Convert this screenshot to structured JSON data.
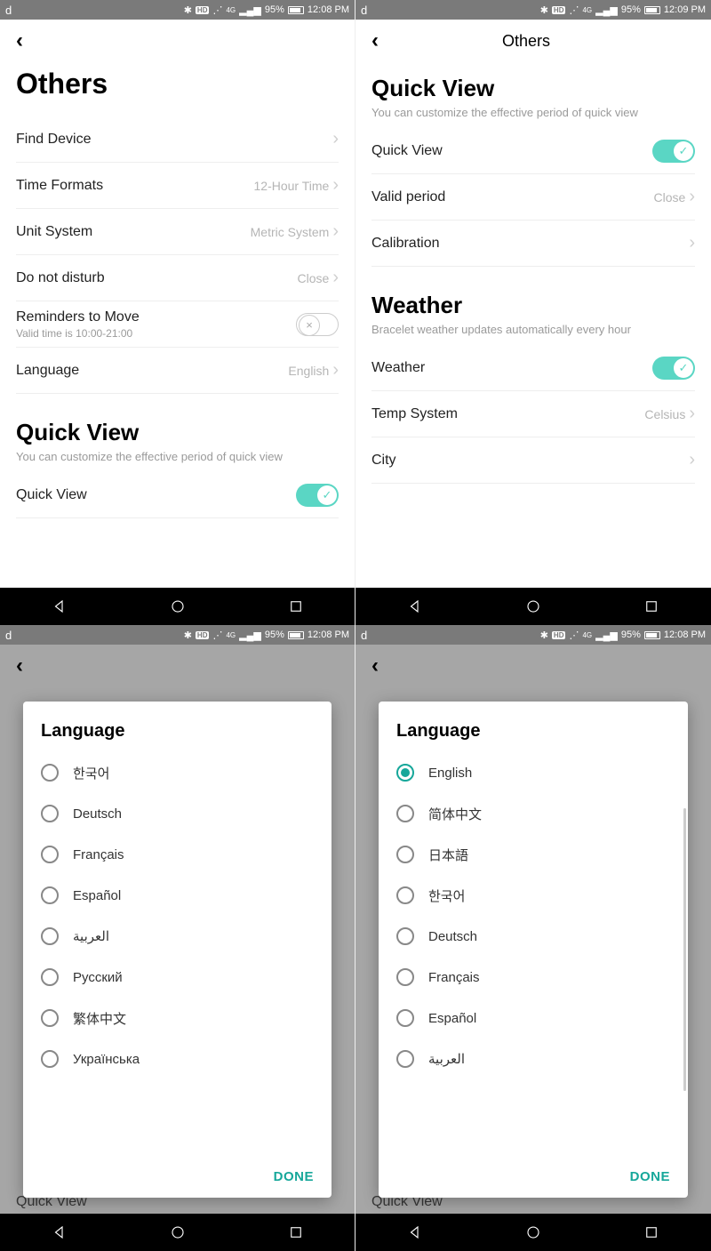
{
  "status": {
    "d": "d",
    "battery": "95%",
    "time1": "12:08 PM",
    "time2": "12:09 PM",
    "hd": "HD",
    "net": "4G"
  },
  "s1": {
    "title": "Others",
    "rows": {
      "find": "Find Device",
      "tf": "Time Formats",
      "tf_v": "12-Hour Time",
      "us": "Unit System",
      "us_v": "Metric System",
      "dnd": "Do not disturb",
      "dnd_v": "Close",
      "rem": "Reminders to Move",
      "rem_sub": "Valid time is 10:00-21:00",
      "lang": "Language",
      "lang_v": "English"
    },
    "qv_title": "Quick View",
    "qv_sub": "You can customize the effective period of quick view",
    "qv_row": "Quick View"
  },
  "s2": {
    "header": "Others",
    "qv_title": "Quick View",
    "qv_sub": "You can customize the effective period of quick view",
    "qv_row": "Quick View",
    "vp": "Valid period",
    "vp_v": "Close",
    "cal": "Calibration",
    "w_title": "Weather",
    "w_sub": "Bracelet weather updates automatically every hour",
    "w_row": "Weather",
    "ts": "Temp System",
    "ts_v": "Celsius",
    "city": "City"
  },
  "dlg": {
    "title": "Language",
    "done": "DONE",
    "listA": [
      "한국어",
      "Deutsch",
      "Français",
      "Español",
      "العربية",
      "Русский",
      "繁体中文",
      "Українська"
    ],
    "listB": [
      "English",
      "简体中文",
      "日本語",
      "한국어",
      "Deutsch",
      "Français",
      "Español",
      "العربية"
    ],
    "selectedB": "English"
  },
  "bg_hint": "Quick View"
}
